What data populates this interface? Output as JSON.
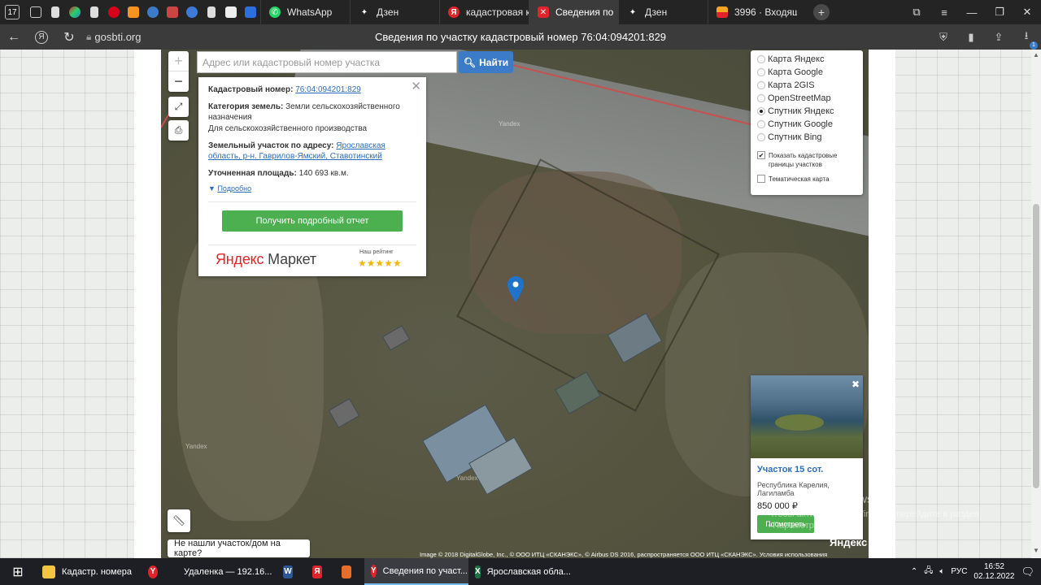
{
  "browser": {
    "tab_count": "17",
    "pinned_icons": [
      "new-tab-icon",
      "document-icon",
      "apps-icon",
      "document-icon",
      "hh-icon",
      "ok-icon",
      "edge-icon",
      "image-icon",
      "camera-icon",
      "document-icon",
      "font-icon",
      "kinopoisk-icon"
    ],
    "tabs": [
      {
        "label": "WhatsApp",
        "icon": "whatsapp-icon",
        "color": "#25d366",
        "active": false
      },
      {
        "label": "Дзен",
        "icon": "zen-icon",
        "color": "#222222",
        "active": false
      },
      {
        "label": "кадастровая кар",
        "icon": "yandex-icon",
        "color": "#e1232b",
        "active": false
      },
      {
        "label": "Сведения по",
        "icon": "gosbti-icon",
        "color": "#e1232b",
        "active": true
      },
      {
        "label": "Дзен",
        "icon": "zen-icon",
        "color": "#222222",
        "active": false
      },
      {
        "label": "3996 · Входящие",
        "icon": "mail-icon",
        "color": "#f5a623",
        "active": false
      }
    ],
    "address": {
      "domain": "gosbti.org",
      "page_title": "Сведения по участку кадастровый номер 76:04:094201:829"
    },
    "download_badge": "1"
  },
  "map": {
    "search": {
      "placeholder": "Адрес или кадастровый номер участка",
      "value": ""
    },
    "find_label": "Найти",
    "watermarks": [
      "Yandex",
      "Yandex",
      "Yandex"
    ],
    "popup": {
      "cadastral_label": "Кадастровый номер:",
      "cadastral_value": "76:04:094201:829",
      "category_label": "Категория земель:",
      "category_value": "Земли сельскохозяйственного назначения",
      "usage": "Для сельскохозяйственного производства",
      "address_label": "Земельный участок по адресу:",
      "address_value": "Ярославская область, р-н. Гаврилов-Ямский, Ставотинский",
      "area_label": "Уточненная площадь:",
      "area_value": "140 693 кв.м.",
      "details_label": "Подробно",
      "report_button": "Получить подробный отчет",
      "brand_ya": "Яндекс",
      "brand_rest": "Маркет",
      "rating_label": "Наш рейтинг",
      "stars": "★★★★★"
    },
    "layers": {
      "options": [
        {
          "label": "Карта Яндекс",
          "selected": false
        },
        {
          "label": "Карта Google",
          "selected": false
        },
        {
          "label": "Карта 2GIS",
          "selected": false
        },
        {
          "label": "OpenStreetMap",
          "selected": false
        },
        {
          "label": "Спутник Яндекс",
          "selected": true
        },
        {
          "label": "Спутник Google",
          "selected": false
        },
        {
          "label": "Спутник Bing",
          "selected": false
        }
      ],
      "checkboxes": [
        {
          "label": "Показать кадастровые границы участков",
          "checked": true
        },
        {
          "label": "Тематическая карта",
          "checked": false
        }
      ]
    },
    "ad": {
      "title": "Участок 15 сот.",
      "location": "Республика Карелия, Лагиламба",
      "price": "850 000 ₽",
      "button": "Посмотреть"
    },
    "not_found": "Не нашли участок/дом на карте?",
    "copyright": "Image © 2018 DigitalGlobe, Inc., © ООО ИТЦ «СКАНЭКС», © Airbus DS 2016, распространяется ООО ИТЦ «СКАНЭКС». Условия использования",
    "ya_logo": "Яндекс",
    "windows_activation_title": "Активация Windows",
    "windows_activation_text": "Чтобы активировать Windows, перейдите в раздел «Параметры»."
  },
  "taskbar": {
    "items": [
      {
        "label": "Кадастр. номера",
        "icon": "folder-icon",
        "color": "#f4c542",
        "active": false
      },
      {
        "label": "",
        "icon": "yandex-browser-icon",
        "color": "#e1232b",
        "active": false
      },
      {
        "label": "Удаленка — 192.16...",
        "icon": "remote-desktop-icon",
        "color": "#3b7bc8",
        "active": false
      },
      {
        "label": "",
        "icon": "word-icon",
        "color": "#2b5797",
        "active": false
      },
      {
        "label": "",
        "icon": "yandex-icon",
        "color": "#e1232b",
        "active": false
      },
      {
        "label": "",
        "icon": "app-icon",
        "color": "#e46f2c",
        "active": false
      },
      {
        "label": "Сведения по участ...",
        "icon": "yandex-browser-icon",
        "color": "#e1232b",
        "active": true
      },
      {
        "label": "Ярославская обла...",
        "icon": "excel-icon",
        "color": "#1f7244",
        "active": false
      }
    ],
    "lang": "РУС",
    "time": "16:52",
    "date": "02.12.2022"
  }
}
